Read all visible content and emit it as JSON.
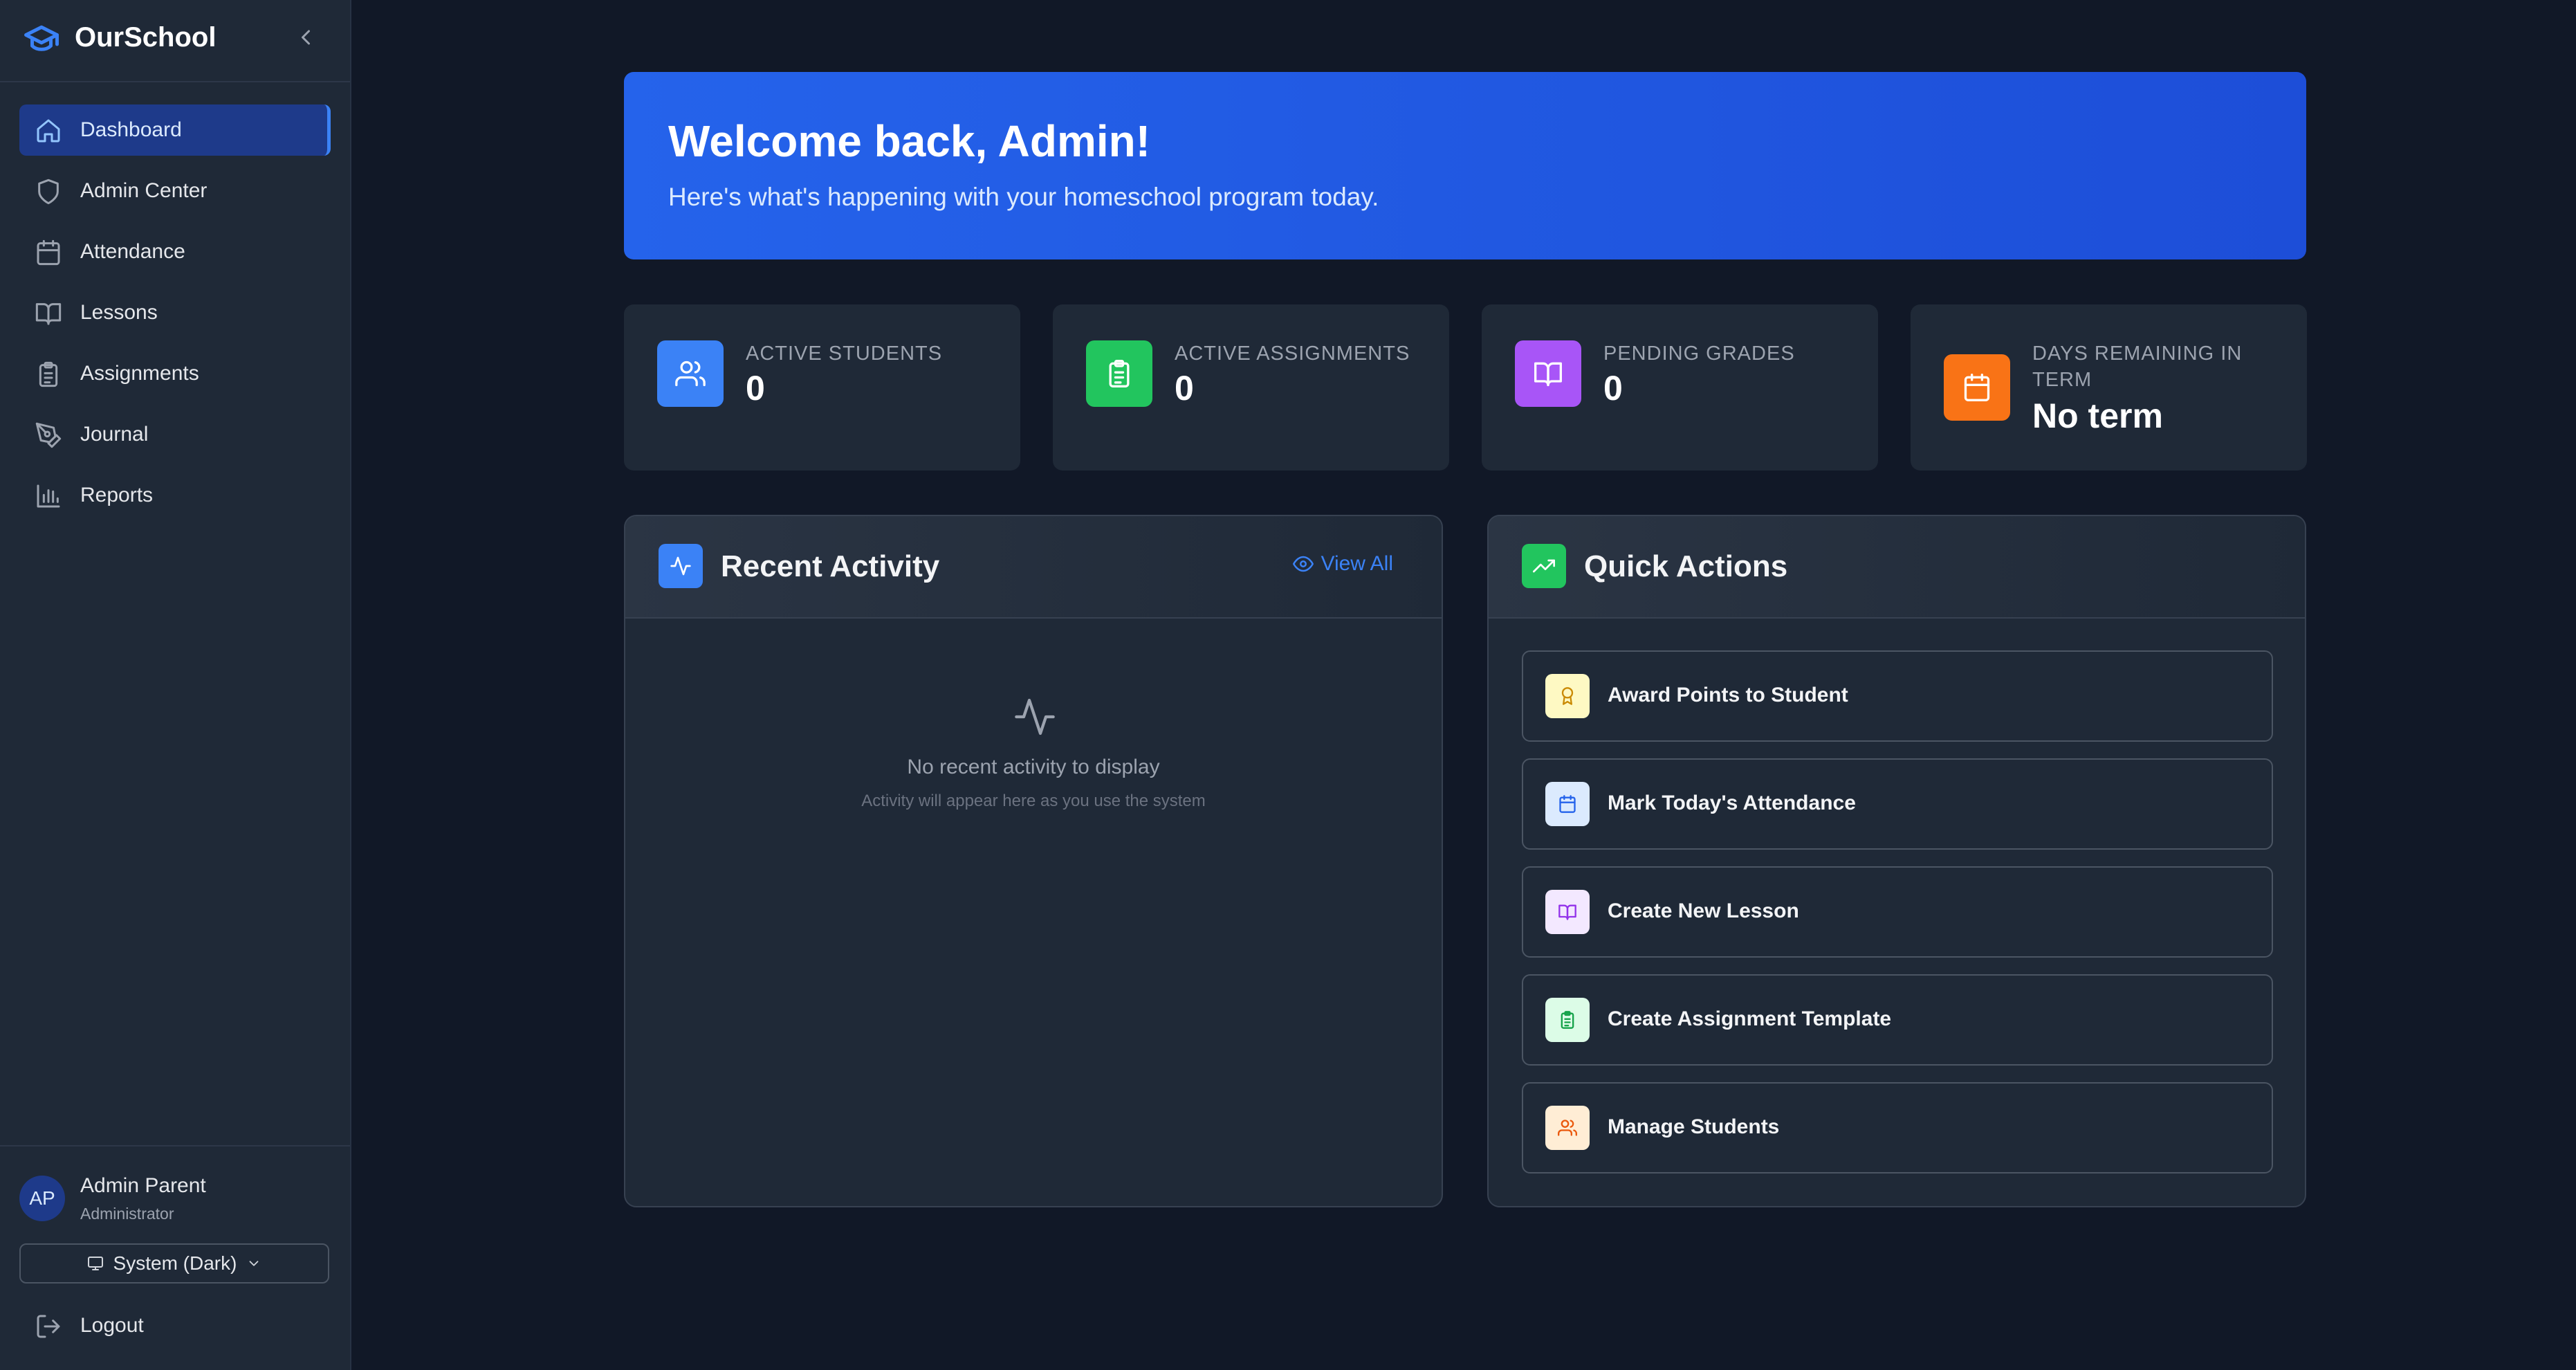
{
  "app": {
    "name": "OurSchool"
  },
  "sidebar": {
    "items": [
      {
        "label": "Dashboard",
        "icon": "home-icon",
        "active": true
      },
      {
        "label": "Admin Center",
        "icon": "shield-icon"
      },
      {
        "label": "Attendance",
        "icon": "calendar-icon"
      },
      {
        "label": "Lessons",
        "icon": "book-open-icon"
      },
      {
        "label": "Assignments",
        "icon": "clipboard-icon"
      },
      {
        "label": "Journal",
        "icon": "pen-tool-icon"
      },
      {
        "label": "Reports",
        "icon": "bar-chart-icon"
      }
    ],
    "user": {
      "initials": "AP",
      "name": "Admin Parent",
      "role": "Administrator"
    },
    "theme": {
      "label": "System (Dark)"
    },
    "logout_label": "Logout"
  },
  "hero": {
    "title": "Welcome back, Admin!",
    "subtitle": "Here's what's happening with your homeschool program today."
  },
  "stats": [
    {
      "label": "ACTIVE STUDENTS",
      "value": "0",
      "icon": "users-icon",
      "color": "#3b82f6"
    },
    {
      "label": "ACTIVE ASSIGNMENTS",
      "value": "0",
      "icon": "clipboard-icon",
      "color": "#22c55e"
    },
    {
      "label": "PENDING GRADES",
      "value": "0",
      "icon": "book-open-icon",
      "color": "#a855f7"
    },
    {
      "label": "DAYS REMAINING IN TERM",
      "value": "No term",
      "icon": "calendar-icon",
      "color": "#f97316"
    }
  ],
  "recent_activity": {
    "title": "Recent Activity",
    "view_all_label": "View All",
    "empty_title": "No recent activity to display",
    "empty_subtitle": "Activity will appear here as you use the system"
  },
  "quick_actions": {
    "title": "Quick Actions",
    "items": [
      {
        "label": "Award Points to Student",
        "icon": "award-icon",
        "bg": "#fef9c3",
        "fg": "#ca8a04"
      },
      {
        "label": "Mark Today's Attendance",
        "icon": "calendar-icon",
        "bg": "#dbeafe",
        "fg": "#2563eb"
      },
      {
        "label": "Create New Lesson",
        "icon": "book-open-icon",
        "bg": "#f3e8ff",
        "fg": "#9333ea"
      },
      {
        "label": "Create Assignment Template",
        "icon": "clipboard-icon",
        "bg": "#dcfce7",
        "fg": "#16a34a"
      },
      {
        "label": "Manage Students",
        "icon": "users-icon",
        "bg": "#ffedd5",
        "fg": "#ea580c"
      }
    ]
  }
}
